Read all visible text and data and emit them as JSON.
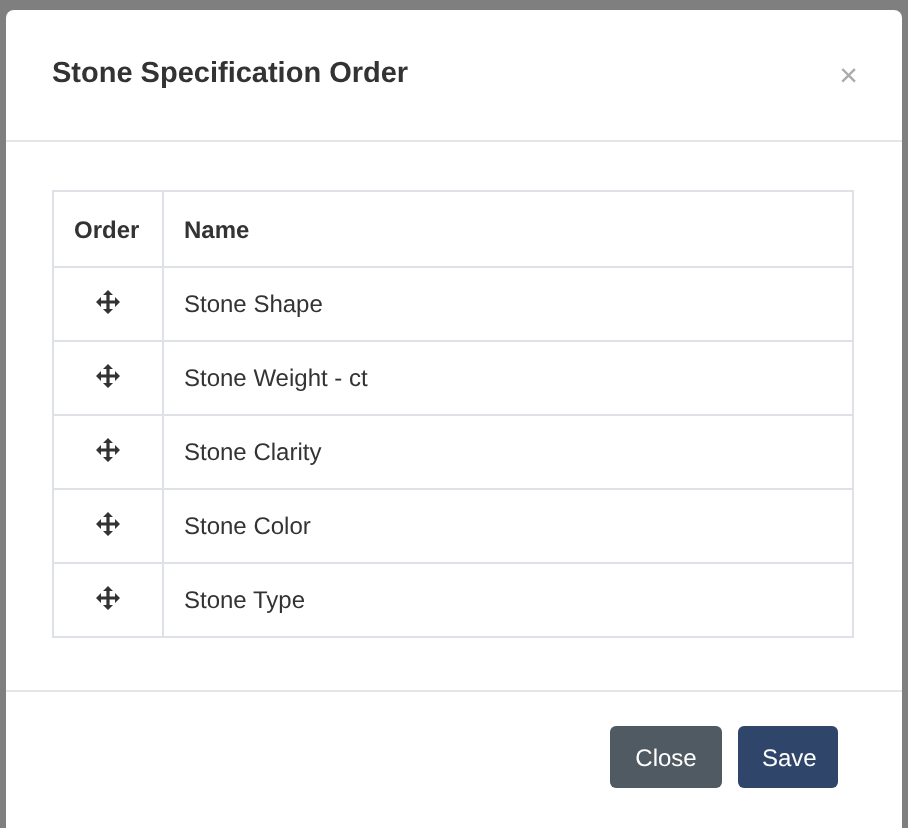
{
  "dialog": {
    "title": "Stone Specification Order",
    "close_icon": "×"
  },
  "table": {
    "columns": [
      "Order",
      "Name"
    ],
    "rows": [
      {
        "name": "Stone Shape"
      },
      {
        "name": "Stone Weight - ct"
      },
      {
        "name": "Stone Clarity"
      },
      {
        "name": "Stone Color"
      },
      {
        "name": "Stone Type"
      }
    ]
  },
  "buttons": [
    {
      "label": "Close",
      "kind": "secondary"
    },
    {
      "label": "Save",
      "kind": "primary"
    }
  ]
}
